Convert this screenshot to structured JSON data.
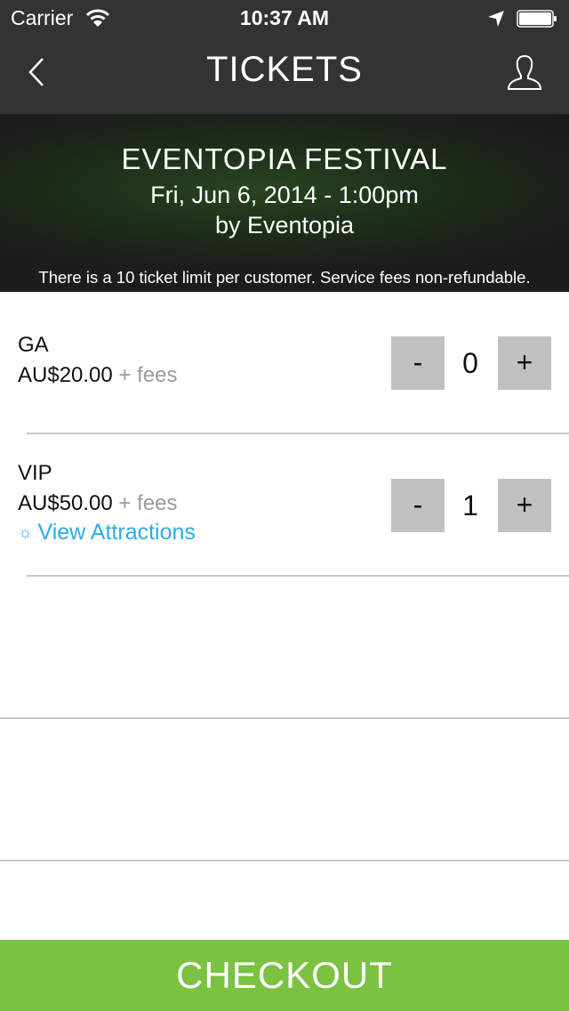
{
  "status_bar": {
    "carrier": "Carrier",
    "time": "10:37 AM",
    "icons": [
      "wifi-icon",
      "location-arrow-icon",
      "battery-icon"
    ]
  },
  "nav": {
    "title": "TICKETS",
    "back_icon": "chevron-left-icon",
    "profile_icon": "user-profile-icon"
  },
  "event": {
    "title": "EVENTOPIA FESTIVAL",
    "date": "Fri, Jun 6, 2014 - 1:00pm",
    "organizer": "by Eventopia",
    "notice": "There is a 10 ticket limit per customer. Service fees non-refundable."
  },
  "tickets": [
    {
      "name": "GA",
      "price": "AU$20.00",
      "fees": "+ fees",
      "quantity": "0",
      "minus": "-",
      "plus": "+"
    },
    {
      "name": "VIP",
      "price": "AU$50.00",
      "fees": "+ fees",
      "quantity": "1",
      "minus": "-",
      "plus": "+",
      "link_icon": "☼",
      "link": "View Attractions"
    }
  ],
  "colors": {
    "header_bg": "#333333",
    "accent_link": "#29aee3",
    "checkout_bg": "#7bc142",
    "stepper_bg": "#c1c1c1"
  },
  "checkout_label": "CHECKOUT"
}
